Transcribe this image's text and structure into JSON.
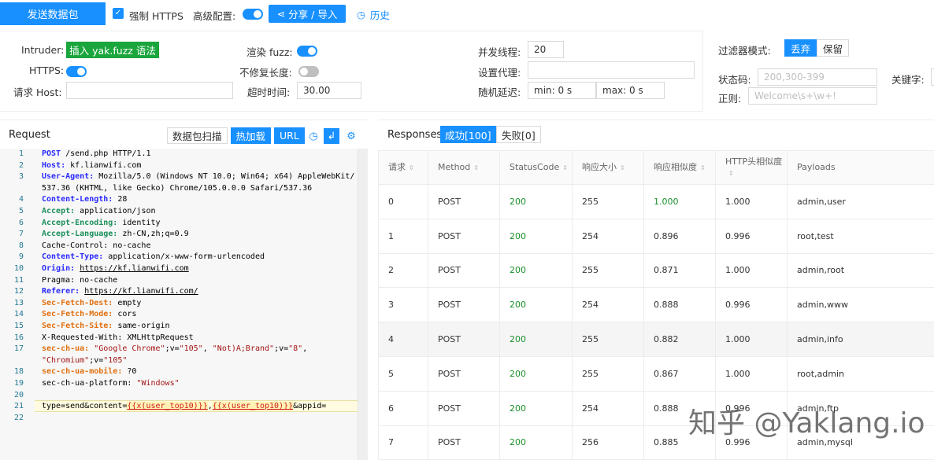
{
  "toolbar": {
    "send_label": "发送数据包",
    "force_https_label": "强制 HTTPS",
    "advanced_label": "高级配置:",
    "share_label": "分享 / 导入",
    "history_label": "历史"
  },
  "config": {
    "intruder_label": "Intruder:",
    "insert_fuzz_label": "插入 yak.fuzz 语法",
    "https_label": "HTTPS:",
    "request_host_label": "请求 Host:",
    "render_fuzz_label": "渲染 fuzz:",
    "no_fix_length_label": "不修复长度:",
    "timeout_label": "超时时间:",
    "timeout_value": "30.00",
    "threads_label": "并发线程:",
    "threads_value": "20",
    "proxy_label": "设置代理:",
    "delay_label": "随机延迟:",
    "delay_min": "min: 0 s",
    "delay_max": "max: 0 s"
  },
  "filter": {
    "mode_label": "过滤器模式:",
    "discard": "丢弃",
    "keep": "保留",
    "status_label": "状态码:",
    "status_placeholder": "200,300-399",
    "keyword_label": "关键字:",
    "regex_label": "正则:",
    "regex_placeholder": "Welcome\\s+\\w+!"
  },
  "request": {
    "title": "Request",
    "scan_label": "数据包扫描",
    "hot_load_label": "热加载",
    "url_label": "URL",
    "line_numbers": [
      "1",
      "2",
      "3",
      "",
      "4",
      "5",
      "6",
      "7",
      "8",
      "9",
      "10",
      "11",
      "12",
      "13",
      "14",
      "15",
      "16",
      "17",
      "",
      "18",
      "19",
      "20",
      "21",
      "22"
    ]
  },
  "responses": {
    "title": "Responses",
    "success_tab": "成功[100]",
    "fail_tab": "失败[0]",
    "columns": [
      "请求",
      "Method",
      "StatusCode",
      "响应大小",
      "响应相似度",
      "HTTP头相似度",
      "Payloads"
    ],
    "rows": [
      [
        "0",
        "POST",
        "200",
        "255",
        "1.000",
        "1.000",
        "admin,user"
      ],
      [
        "1",
        "POST",
        "200",
        "254",
        "0.896",
        "0.996",
        "root,test"
      ],
      [
        "2",
        "POST",
        "200",
        "255",
        "0.871",
        "1.000",
        "admin,root"
      ],
      [
        "3",
        "POST",
        "200",
        "254",
        "0.888",
        "0.996",
        "admin,www"
      ],
      [
        "4",
        "POST",
        "200",
        "255",
        "0.882",
        "1.000",
        "admin,info"
      ],
      [
        "5",
        "POST",
        "200",
        "255",
        "0.867",
        "1.000",
        "root,admin"
      ],
      [
        "6",
        "POST",
        "200",
        "254",
        "0.888",
        "0.996",
        "admin,ftp"
      ],
      [
        "7",
        "POST",
        "200",
        "256",
        "0.885",
        "0.996",
        "admin,mysql"
      ]
    ]
  },
  "watermark": "知乎 @Yaklang.io"
}
